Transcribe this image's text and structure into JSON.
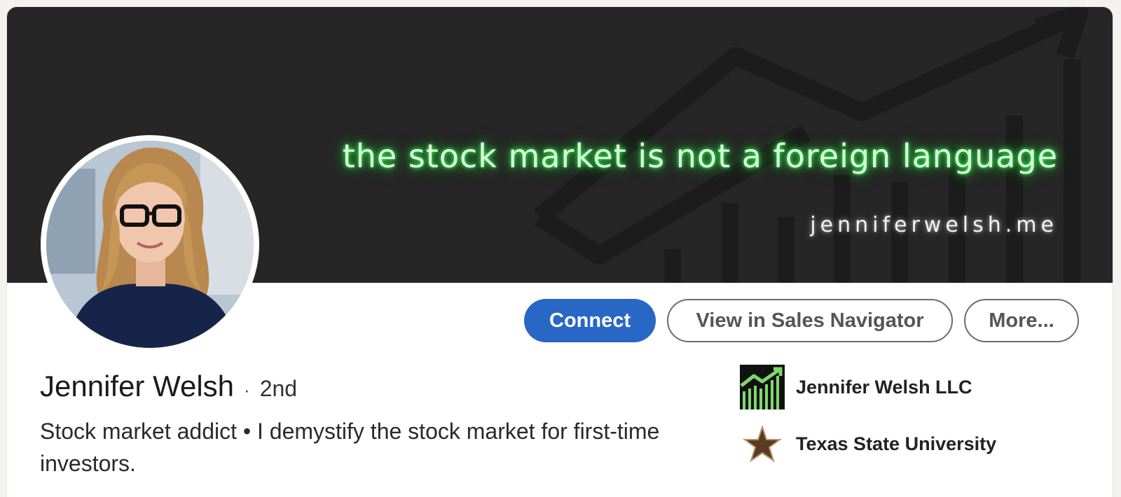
{
  "banner": {
    "tagline": "the stock market is not a foreign language",
    "website": "jenniferwelsh.me"
  },
  "profile": {
    "name": "Jennifer Welsh",
    "separator": "·",
    "degree": "2nd",
    "headline": "Stock market addict • I demystify the stock market for first-time investors."
  },
  "actions": {
    "connect": "Connect",
    "sales_navigator": "View in Sales Navigator",
    "more": "More..."
  },
  "affiliations": {
    "company": "Jennifer Welsh LLC",
    "school": "Texas State University"
  },
  "colors": {
    "primary": "#2867c5",
    "banner_bg": "#262626",
    "neon_green": "#3dff5a"
  },
  "icons": {
    "company_logo": "stock-chart-logo",
    "school_logo": "star-logo"
  }
}
